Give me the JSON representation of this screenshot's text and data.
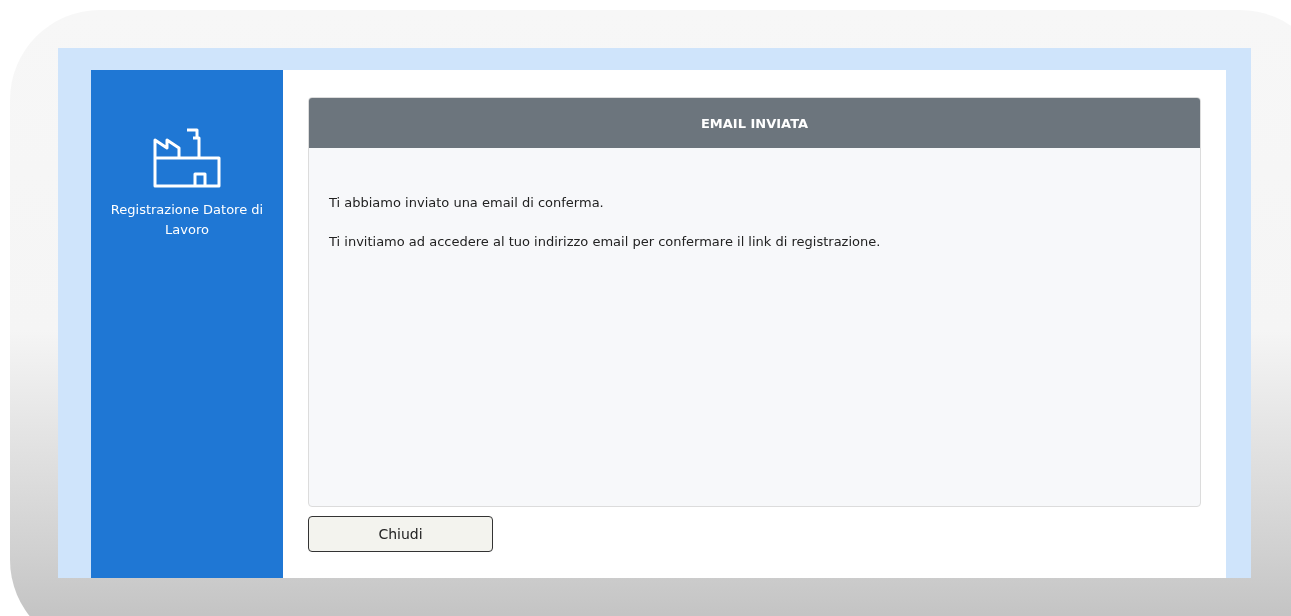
{
  "sidebar": {
    "title": "Registrazione Datore di Lavoro"
  },
  "card": {
    "title": "EMAIL INVIATA",
    "paragraphs": [
      "Ti abbiamo inviato una email di conferma.",
      "Ti invitiamo ad accedere al tuo indirizzo email per confermare il link di registrazione."
    ]
  },
  "buttons": [
    "Chiudi"
  ]
}
